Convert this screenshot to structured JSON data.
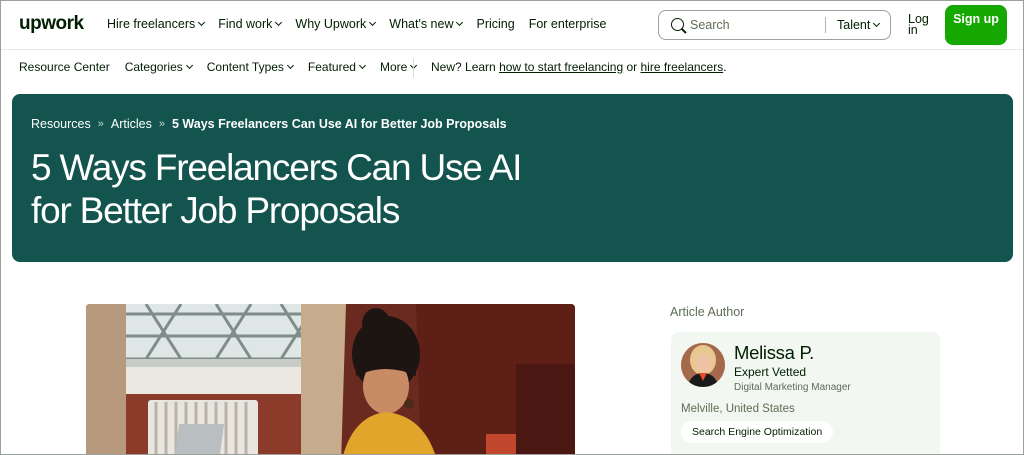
{
  "brand": {
    "logo_text": "upwork",
    "accent": "#14a800",
    "hero_bg": "#13544e"
  },
  "nav": {
    "links": [
      {
        "label": "Hire freelancers",
        "has_menu": true
      },
      {
        "label": "Find work",
        "has_menu": true
      },
      {
        "label": "Why Upwork",
        "has_menu": true
      },
      {
        "label": "What's new",
        "has_menu": true
      },
      {
        "label": "Pricing",
        "has_menu": false
      },
      {
        "label": "For enterprise",
        "has_menu": false
      }
    ],
    "search": {
      "placeholder": "Search",
      "category": "Talent"
    },
    "login_label": "Log in",
    "signup_label": "Sign up"
  },
  "subnav": {
    "items": [
      {
        "label": "Resource Center",
        "has_menu": false
      },
      {
        "label": "Categories",
        "has_menu": true
      },
      {
        "label": "Content Types",
        "has_menu": true
      },
      {
        "label": "Featured",
        "has_menu": true
      },
      {
        "label": "More",
        "has_menu": true
      }
    ],
    "promo": {
      "prefix": "New? Learn",
      "link1": "how to start freelancing",
      "middle": "or",
      "link2": "hire freelancers",
      "suffix": "."
    }
  },
  "hero": {
    "breadcrumb": [
      "Resources",
      "Articles",
      "5 Ways Freelancers Can Use AI for Better Job Proposals"
    ],
    "breadcrumb_sep": "»",
    "title": "5 Ways Freelancers Can Use AI for Better Job Proposals"
  },
  "author": {
    "heading": "Article Author",
    "name": "Melissa P.",
    "badge": "Expert Vetted",
    "role": "Digital Marketing Manager",
    "location": "Melville, United States",
    "skill": "Search Engine Optimization"
  }
}
